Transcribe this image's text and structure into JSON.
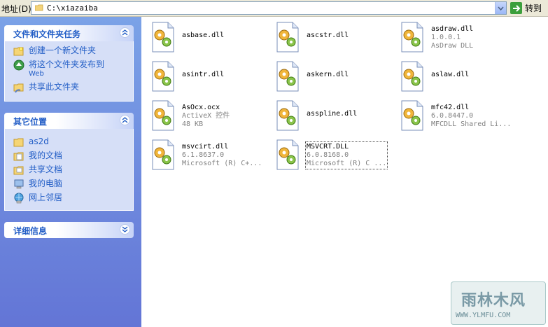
{
  "address_bar": {
    "label": "地址",
    "shortcut": "(D)",
    "path": "C:\\xiazaiba",
    "go_label": "转到"
  },
  "left_pane": {
    "file_tasks": {
      "title": "文件和文件夹任务",
      "items": [
        {
          "label": "创建一个新文件夹",
          "icon": "new-folder-icon"
        },
        {
          "label": "将这个文件夹发布到",
          "sub": "Web",
          "icon": "publish-web-icon"
        },
        {
          "label": "共享此文件夹",
          "icon": "share-folder-icon"
        }
      ]
    },
    "other_places": {
      "title": "其它位置",
      "items": [
        {
          "label": "as2d",
          "icon": "folder-icon"
        },
        {
          "label": "我的文档",
          "icon": "my-documents-icon"
        },
        {
          "label": "共享文档",
          "icon": "shared-documents-icon"
        },
        {
          "label": "我的电脑",
          "icon": "my-computer-icon"
        },
        {
          "label": "网上邻居",
          "icon": "network-places-icon"
        }
      ]
    },
    "details": {
      "title": "详细信息"
    }
  },
  "files": [
    {
      "name": "asbase.dll",
      "line2": "",
      "line3": ""
    },
    {
      "name": "ascstr.dll",
      "line2": "",
      "line3": ""
    },
    {
      "name": "asdraw.dll",
      "line2": "1.0.0.1",
      "line3": "AsDraw DLL"
    },
    {
      "name": "asintr.dll",
      "line2": "",
      "line3": ""
    },
    {
      "name": "askern.dll",
      "line2": "",
      "line3": ""
    },
    {
      "name": "aslaw.dll",
      "line2": "",
      "line3": ""
    },
    {
      "name": "AsOcx.ocx",
      "line2": "ActiveX 控件",
      "line3": "48 KB"
    },
    {
      "name": "asspline.dll",
      "line2": "",
      "line3": ""
    },
    {
      "name": "mfc42.dll",
      "line2": "6.0.8447.0",
      "line3": "MFCDLL Shared Li..."
    },
    {
      "name": "msvcirt.dll",
      "line2": "6.1.8637.0",
      "line3": "Microsoft (R) C+..."
    },
    {
      "name": "MSVCRT.DLL",
      "line2": "6.0.8168.0",
      "line3": "Microsoft (R) C ..."
    }
  ],
  "watermark": {
    "title": "雨林木风",
    "sub": "WWW.YLMFU.COM"
  },
  "colors": {
    "pane_gradient_top": "#7ba2e7",
    "pane_gradient_bottom": "#6375d6",
    "link": "#215dc6",
    "panel_body": "#d6dff7"
  }
}
